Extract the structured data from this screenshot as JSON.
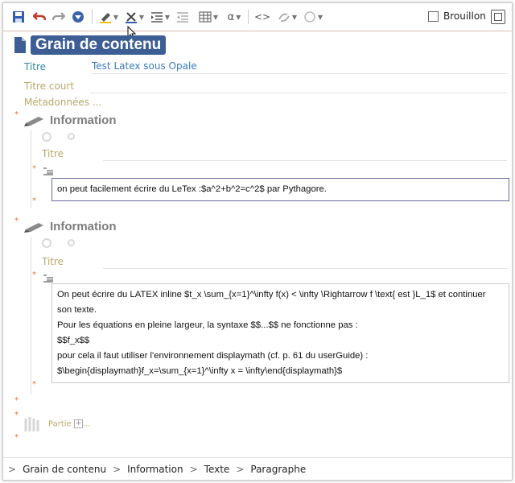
{
  "toolbar": {
    "brouillon_label": "Brouillon",
    "alpha_label": "α",
    "code_label": "<>",
    "icons": [
      "save-icon",
      "undo-icon",
      "redo-icon",
      "shield-icon",
      "highlight-icon",
      "clear-format-icon",
      "indent-icon",
      "outdent-icon",
      "table-icon",
      "alpha-icon",
      "code-icon",
      "link-icon",
      "unlink-icon"
    ]
  },
  "page": {
    "title": "Grain de contenu",
    "field_titre_label": "Titre",
    "field_titre_value": "Test Latex sous Opale",
    "field_titre_court_label": "Titre court",
    "field_meta_label": "Métadonnées ..."
  },
  "sections": [
    {
      "heading": "Information",
      "titre_label": "Titre",
      "paragraph": [
        "on peut facilement écrire du LeTex :$a^2+b^2=c^2$ par Pythagore."
      ]
    },
    {
      "heading": "Information",
      "titre_label": "Titre",
      "paragraph": [
        "On peut écrire du LATEX inline $t_x \\sum_{x=1}^\\infty f(x) < \\infty \\Rightarrow f \\text{ est }L_1$ et continuer",
        "son texte.",
        "Pour les équations en pleine largeur, la syntaxe $$...$$ ne fonctionne pas :",
        "$$f_x$$",
        "pour cela il faut utiliser l'environnement displaymath (cf. p. 61 du userGuide) :",
        "$\\begin{displaymath}f_x=\\sum_{x=1}^\\infty x = \\infty\\end{displaymath}$"
      ]
    }
  ],
  "partie_label": "Partie",
  "partie_more": "...",
  "breadcrumb": [
    "Grain de contenu",
    "Information",
    "Texte",
    "Paragraphe"
  ],
  "colors": {
    "title_bg": "#3d5d95",
    "label_teal": "#2f8a9a",
    "label_olive": "#b9a66c",
    "star": "#e07a3a"
  }
}
